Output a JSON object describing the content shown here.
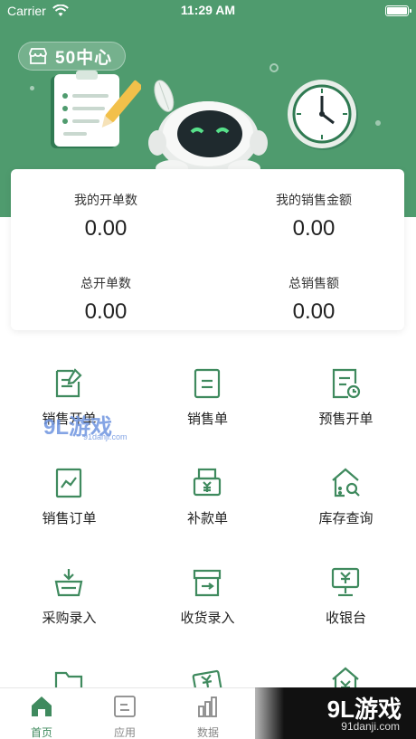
{
  "status_bar": {
    "carrier": "Carrier",
    "time": "11:29 AM"
  },
  "header": {
    "badge_label": "50中心"
  },
  "stats": [
    {
      "label": "我的开单数",
      "value": "0.00"
    },
    {
      "label": "我的销售金额",
      "value": "0.00"
    },
    {
      "label": "总开单数",
      "value": "0.00"
    },
    {
      "label": "总销售额",
      "value": "0.00"
    }
  ],
  "grid": [
    {
      "label": "销售开单",
      "icon": "edit-doc-icon"
    },
    {
      "label": "销售单",
      "icon": "doc-icon"
    },
    {
      "label": "预售开单",
      "icon": "doc-clock-icon"
    },
    {
      "label": "销售订单",
      "icon": "trend-doc-icon"
    },
    {
      "label": "补款单",
      "icon": "yen-printer-icon"
    },
    {
      "label": "库存查询",
      "icon": "house-search-icon"
    },
    {
      "label": "采购录入",
      "icon": "basket-icon"
    },
    {
      "label": "收货录入",
      "icon": "box-icon"
    },
    {
      "label": "收银台",
      "icon": "cash-register-icon"
    }
  ],
  "tabs": [
    {
      "label": "首页",
      "icon": "home-icon",
      "active": true
    },
    {
      "label": "应用",
      "icon": "app-icon",
      "active": false
    },
    {
      "label": "数据",
      "icon": "chart-icon",
      "active": false
    }
  ],
  "watermark": {
    "title": "9L游戏",
    "site": "91danji.com",
    "mid_title": "9L游戏",
    "mid_site": "91danji.com"
  },
  "colors": {
    "brand_green": "#4f9b6e",
    "icon_green": "#3f8a5e"
  }
}
